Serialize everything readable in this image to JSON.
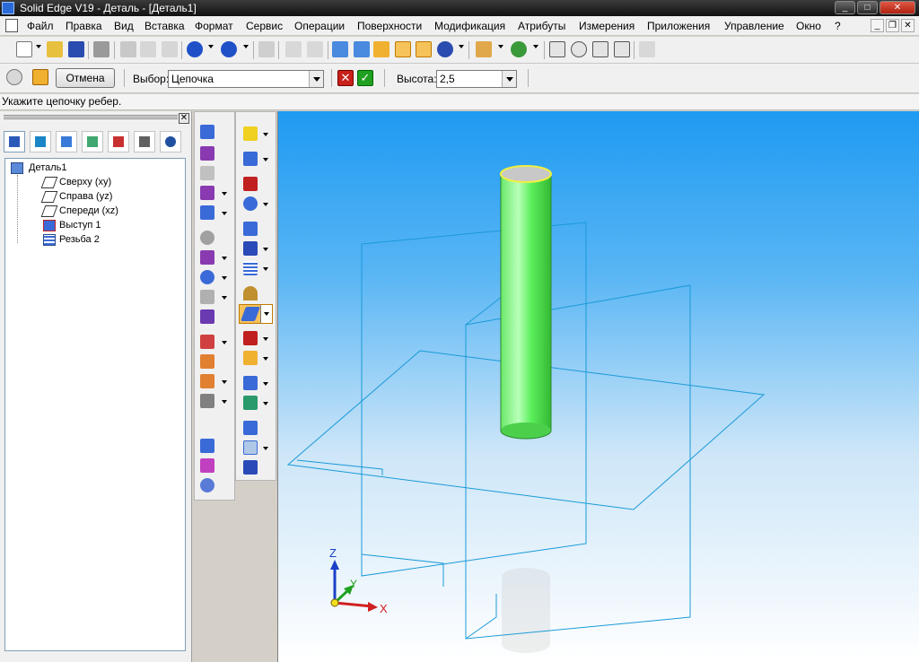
{
  "window": {
    "title": "Solid Edge V19 - Деталь - [Деталь1]"
  },
  "menu": {
    "items": [
      {
        "label": "Файл"
      },
      {
        "label": "Правка"
      },
      {
        "label": "Вид"
      },
      {
        "label": "Вставка"
      },
      {
        "label": "Формат"
      },
      {
        "label": "Сервис"
      },
      {
        "label": "Операции"
      },
      {
        "label": "Поверхности"
      },
      {
        "label": "Модификация"
      },
      {
        "label": "Атрибуты"
      },
      {
        "label": "Измерения"
      },
      {
        "label": "Приложения"
      },
      {
        "label": "Управление"
      },
      {
        "label": "Окно"
      },
      {
        "label": "?"
      }
    ]
  },
  "ribbon": {
    "cancel_label": "Отмена",
    "select_label": "Выбор:",
    "select_value": "Цепочка",
    "height_label": "Высота:",
    "height_value": "2,5"
  },
  "prompt": {
    "text": "Укажите цепочку ребер."
  },
  "tree": {
    "root": "Деталь1",
    "items": [
      {
        "label": "Сверху (xy)",
        "icon": "plane-icon"
      },
      {
        "label": "Справа (yz)",
        "icon": "plane-icon"
      },
      {
        "label": "Спереди (xz)",
        "icon": "plane-icon"
      },
      {
        "label": "Выступ 1",
        "icon": "protrusion-icon"
      },
      {
        "label": "Резьба 2",
        "icon": "thread-icon"
      }
    ]
  },
  "triad": {
    "z": "Z",
    "y": "Y",
    "x": "X"
  },
  "colors": {
    "cylinder": "#5cf05c",
    "plane": "#1a9ad8",
    "highlight": "#f0b030"
  }
}
